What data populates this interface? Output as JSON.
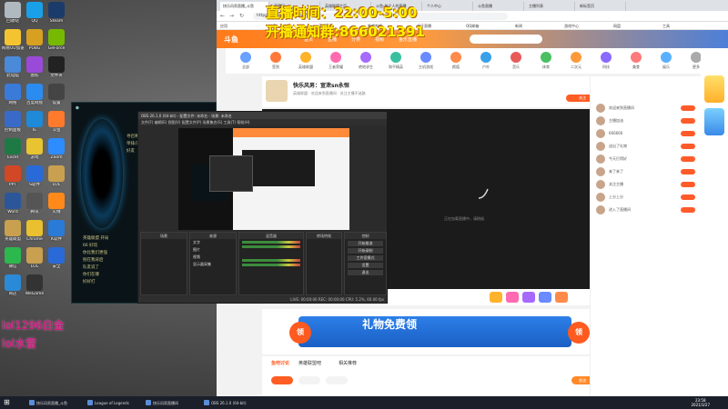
{
  "overlay": {
    "schedule": "直播时间：22:00-5:00",
    "group": "开播通知群:866021391",
    "rank_line1": "lol1296白金",
    "rank_line2": "lol水雷"
  },
  "desktop_icons": [
    {
      "label": "回收站",
      "color": "#b0b8c0"
    },
    {
      "label": "QQ",
      "color": "#1aa0e8"
    },
    {
      "label": "Steam",
      "color": "#1b3b6a"
    },
    {
      "label": "网易UU加速器",
      "color": "#f4c430"
    },
    {
      "label": "PUBG",
      "color": "#d8a020"
    },
    {
      "label": "GeForce",
      "color": "#76b900"
    },
    {
      "label": "此电脑",
      "color": "#4a8ad8"
    },
    {
      "label": "图标",
      "color": "#9a4ad8"
    },
    {
      "label": "文件夹",
      "color": "#222"
    },
    {
      "label": "网络",
      "color": "#3a7ad8"
    },
    {
      "label": "百度网盘",
      "color": "#2a8cf0"
    },
    {
      "label": "设置",
      "color": "#444"
    },
    {
      "label": "控制面板",
      "color": "#3a6ac8"
    },
    {
      "label": "IE",
      "color": "#1e8ad8"
    },
    {
      "label": "斗鱼",
      "color": "#ff7a2a"
    },
    {
      "label": "Excel",
      "color": "#1e7a45"
    },
    {
      "label": "游戏",
      "color": "#e8c430"
    },
    {
      "label": "Zoom",
      "color": "#2d8cff"
    },
    {
      "label": "PPT",
      "color": "#d24726"
    },
    {
      "label": "S软件",
      "color": "#2a6ad8"
    },
    {
      "label": "LOL",
      "color": "#c8a050"
    },
    {
      "label": "Word",
      "color": "#2b579a"
    },
    {
      "label": "腾讯",
      "color": "#555"
    },
    {
      "label": "火绒",
      "color": "#ff8a1a"
    },
    {
      "label": "英雄联盟",
      "color": "#c8a050"
    },
    {
      "label": "Chrome",
      "color": "#e8c030"
    },
    {
      "label": "K软件",
      "color": "#2a7ad8"
    },
    {
      "label": "微信",
      "color": "#2db84d"
    },
    {
      "label": "LOL",
      "color": "#c8a050"
    },
    {
      "label": "安全",
      "color": "#2a6ad8"
    },
    {
      "label": "商店",
      "color": "#2a8ad8"
    },
    {
      "label": "WeGame",
      "color": "#333"
    }
  ],
  "lol": {
    "side": [
      "寻召唤",
      "单排/双排",
      "好友"
    ],
    "chat": [
      "英雄联盟 开局",
      "66 好玩",
      "你比我们更强",
      "别在我背后",
      "队友说了",
      "你们在哪",
      "好好打"
    ]
  },
  "browser": {
    "tabs": [
      "快乐风男直播_斗鱼",
      "直播间",
      "英雄联盟主页",
      "斗鱼-每个人的直播",
      "个人中心",
      "斗鱼直播",
      "主播列表",
      "新标签页"
    ],
    "url": "https://www.douyu.com/",
    "bookmarks": [
      "应用",
      "斗鱼",
      "英雄联盟",
      "哔哩哔哩",
      "虎牙直播",
      "QQ邮箱",
      "新闻",
      "游戏中心",
      "网盘",
      "工具"
    ],
    "nav": [
      "首页",
      "直播",
      "分类",
      "视频",
      "鱼乐直播"
    ],
    "categories": [
      "全部",
      "签到",
      "英雄联盟",
      "王者荣耀",
      "绝地求生",
      "和平精英",
      "主机游戏",
      "颜值",
      "户外",
      "音乐",
      "体育",
      "二次元",
      "科技",
      "美食",
      "娱乐",
      "更多"
    ],
    "room": {
      "title": "快乐风男：宣泄sn永恒",
      "sub": "英雄联盟 · 欢迎来到直播间 · 关注主播不迷路",
      "follow": "关注"
    },
    "player_status": "正在加载直播中，请稍候",
    "banner": {
      "ling": "领",
      "text": "礼物免费领"
    },
    "bottom_tabs": [
      "鱼吧讨论",
      "英雄联盟吧",
      "相关推荐"
    ],
    "chat_rows": [
      "欢迎来到直播间",
      "主播加油",
      "666666",
      "送出了礼物",
      "今天打得好",
      "来了来了",
      "关注主播",
      "上分上分",
      "进入了直播间"
    ],
    "pill_send": "发送"
  },
  "obs": {
    "title": "OBS 26.1.0 (64-bit) - 配置文件: 未命名 - 场景: 未命名",
    "menu": "文件(F)  编辑(E)  视图(V)  配置文件(P)  场景集合(S)  工具(T)  帮助(H)",
    "panels": {
      "scenes": "场景",
      "sources": "来源",
      "mixer": "混音器",
      "transitions": "转场特效",
      "controls": "控制"
    },
    "sources": [
      "文字",
      "图片",
      "视频",
      "显示器采集"
    ],
    "controls": [
      "开始推流",
      "开始录制",
      "工作室模式",
      "设置",
      "退出"
    ],
    "status": "LIVE: 00:00:00  REC: 00:00:00  CPU: 5.2%, 60.00 fps"
  },
  "taskbar": {
    "items": [
      "快乐风男直播_斗鱼",
      "League of Legends",
      "快乐风男直播间",
      "OBS 26.1.0 (64-bit)"
    ],
    "time": "23:58",
    "date": "2021/3/27"
  }
}
